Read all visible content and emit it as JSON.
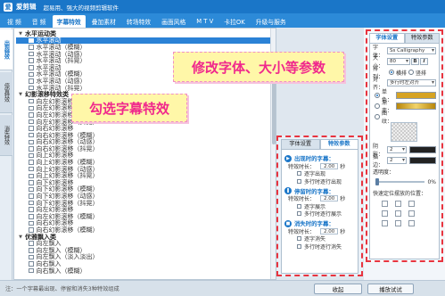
{
  "app": {
    "logo_char": "爱",
    "name": "爱剪辑",
    "slogan": "超易用、强大的视频剪辑软件"
  },
  "tabs": [
    {
      "label": "视 频",
      "active": false
    },
    {
      "label": "音 频",
      "active": false
    },
    {
      "label": "字幕特效",
      "active": true
    },
    {
      "label": "叠加素材",
      "active": false
    },
    {
      "label": "转场特效",
      "active": false
    },
    {
      "label": "画面风格",
      "active": false
    },
    {
      "label": "M T V",
      "active": false
    },
    {
      "label": "卡拉OK",
      "active": false
    },
    {
      "label": "升级与服务",
      "active": false
    }
  ],
  "side_tabs": [
    {
      "label": "出现特效",
      "active": true
    },
    {
      "label": "停留特效",
      "active": false
    },
    {
      "label": "消失特效",
      "active": false
    }
  ],
  "effects": [
    {
      "type": "group",
      "label": "水平运动类"
    },
    {
      "type": "item",
      "label": "水平滚动",
      "selected": true
    },
    {
      "type": "item",
      "label": "水平滚动（模糊）"
    },
    {
      "type": "item",
      "label": "水平滚动（动感）"
    },
    {
      "type": "item",
      "label": "水平滚动（抖晃）"
    },
    {
      "type": "item",
      "label": "水平滚动"
    },
    {
      "type": "item",
      "label": "水平滚动（模糊）"
    },
    {
      "type": "item",
      "label": "水平滚动（动感）"
    },
    {
      "type": "item",
      "label": "水平滚动（抖晃）"
    },
    {
      "type": "group",
      "label": "幻影滚移特效类"
    },
    {
      "type": "item",
      "label": "向左幻影滚移"
    },
    {
      "type": "item",
      "label": "向左幻影滚移（模糊）"
    },
    {
      "type": "item",
      "label": "向左幻影滚移（动感）"
    },
    {
      "type": "item",
      "label": "向左幻影滚移（抖晃）"
    },
    {
      "type": "item",
      "label": "向右幻影滚移"
    },
    {
      "type": "item",
      "label": "向右幻影滚移（模糊）"
    },
    {
      "type": "item",
      "label": "向右幻影滚移（动感）"
    },
    {
      "type": "item",
      "label": "向右幻影滚移（抖晃）"
    },
    {
      "type": "item",
      "label": "向上幻影滚移"
    },
    {
      "type": "item",
      "label": "向上幻影滚移（模糊）"
    },
    {
      "type": "item",
      "label": "向上幻影滚移（动感）"
    },
    {
      "type": "item",
      "label": "向上幻影滚移（抖晃）"
    },
    {
      "type": "item",
      "label": "向下幻影滚移"
    },
    {
      "type": "item",
      "label": "向下幻影滚移（模糊）"
    },
    {
      "type": "item",
      "label": "向下幻影滚移（动感）"
    },
    {
      "type": "item",
      "label": "向下幻影滚移（抖晃）"
    },
    {
      "type": "item",
      "label": "向左幻影滚移"
    },
    {
      "type": "item",
      "label": "向左幻影滚移（模糊）"
    },
    {
      "type": "item",
      "label": "向右幻影滚移"
    },
    {
      "type": "item",
      "label": "向右幻影滚移（模糊）"
    },
    {
      "type": "group",
      "label": "优雅飘入类"
    },
    {
      "type": "item",
      "label": "向左飘入"
    },
    {
      "type": "item",
      "label": "向左飘入（模糊）"
    },
    {
      "type": "item",
      "label": "向左飘入（淡入淡出）"
    },
    {
      "type": "item",
      "label": "向右飘入"
    },
    {
      "type": "item",
      "label": "向右飘入（模糊）"
    }
  ],
  "annotations": {
    "font_hint": "修改字体、大小等参数",
    "effect_hint": "勾选字幕特效"
  },
  "inner_settings": {
    "tabs": [
      "字体设置",
      "特效参数"
    ],
    "active_tab": 1,
    "sections": [
      {
        "title": "出现时的字幕：",
        "duration_label": "特效时长：",
        "duration_value": "2.00",
        "unit": "秒",
        "options": [
          "逐字出现",
          "多行时逐行出现"
        ]
      },
      {
        "title": "停留时的字幕：",
        "duration_label": "特效时长：",
        "duration_value": "2.00",
        "unit": "秒",
        "options": [
          "逐字展示",
          "多行时逐行展示"
        ]
      },
      {
        "title": "消失时的字幕：",
        "duration_label": "特效时长：",
        "duration_value": "2.00",
        "unit": "秒",
        "options": [
          "逐字消失",
          "多行时逐行消失"
        ]
      }
    ]
  },
  "font_panel": {
    "tabs": [
      "字体设置",
      "特效参数"
    ],
    "active_tab": 0,
    "font_label": "字体：",
    "font_value": "Ss Calligraphy",
    "size_label": "大小：",
    "size_value": "80",
    "bold_label": "B",
    "italic_label": "I",
    "layout_label": "排列：",
    "layout_options": [
      "横排",
      "竖排"
    ],
    "align_label": "对齐：",
    "align_value": "多行时左对齐",
    "fill_options": [
      {
        "label": "单色："
      },
      {
        "label": "渐变："
      },
      {
        "label": "图纹："
      }
    ],
    "shadow_label": "阴影：",
    "shadow_value": "2",
    "outline_label": "描边：",
    "outline_value": "2",
    "opacity_label": "透明度：",
    "opacity_value": "0%",
    "position_label": "快速定位摆放的位置："
  },
  "status": {
    "hint": "注：一个字幕最出现、停留和消失3种特效组成",
    "collapse_label": "收起",
    "preview_label": "播放试试"
  }
}
